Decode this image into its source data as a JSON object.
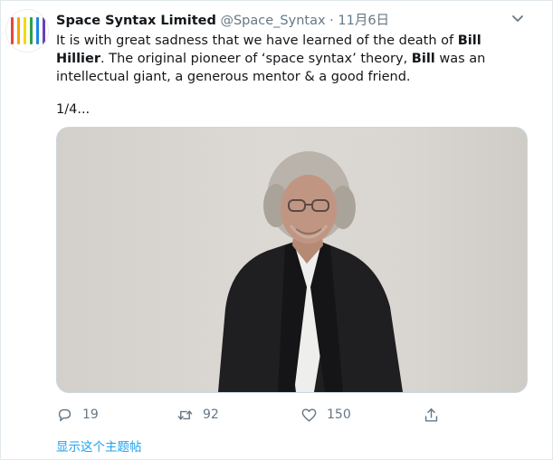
{
  "tweet": {
    "author_name": "Space Syntax Limited",
    "handle": "@Space_Syntax",
    "separator": "·",
    "date": "11月6日",
    "text": {
      "part1": "It is with great sadness that we have learned of the death of ",
      "bold1": "Bill Hillier",
      "part2": ". The original pioneer of ‘space syntax’ theory, ",
      "bold2": "Bill",
      "part3": " was an intellectual giant, a generous mentor & a good friend."
    },
    "page_indicator": "1/4..."
  },
  "avatar": {
    "bar_colors": [
      "#e8453c",
      "#f7a600",
      "#f5d90a",
      "#2ea043",
      "#1e88e5",
      "#6a3fb5"
    ]
  },
  "actions": {
    "reply_count": "19",
    "retweet_count": "92",
    "like_count": "150"
  },
  "thread_link": "显示这个主题帖",
  "colors": {
    "link": "#1da1f2",
    "secondary": "#657786",
    "text": "#14171a"
  }
}
